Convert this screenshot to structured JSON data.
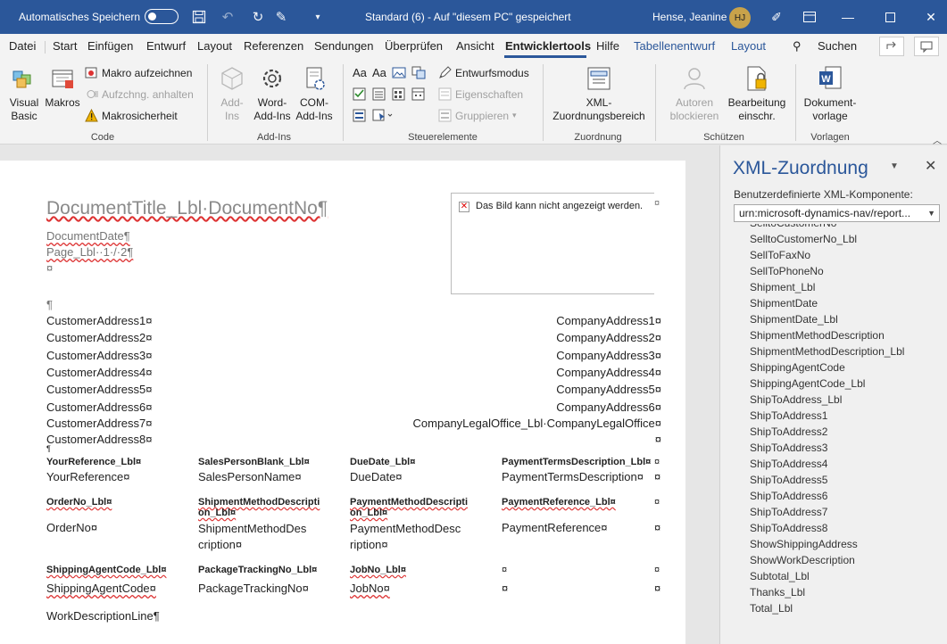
{
  "titlebar": {
    "autosave_label": "Automatisches Speichern",
    "doc_title": "Standard (6)  -  Auf \"diesem PC\" gespeichert",
    "user_name": "Hense, Jeanine",
    "user_initials": "HJ"
  },
  "tabs": [
    "Datei",
    "Start",
    "Einfügen",
    "Entwurf",
    "Layout",
    "Referenzen",
    "Sendungen",
    "Überprüfen",
    "Ansicht",
    "Entwicklertools",
    "Hilfe",
    "Tabellenentwurf",
    "Layout"
  ],
  "search_label": "Suchen",
  "ribbon": {
    "code": {
      "label": "Code",
      "visual_basic": "Visual Basic",
      "macros": "Makros",
      "record_macro": "Makro aufzeichnen",
      "pause_recording": "Aufzchng. anhalten",
      "macro_security": "Makrosicherheit"
    },
    "addins": {
      "label": "Add-Ins",
      "addins": "Add-Ins",
      "word_addins": "Word-Add-Ins",
      "com_addins": "COM-Add-Ins"
    },
    "controls": {
      "label": "Steuerelemente",
      "design_mode": "Entwurfsmodus",
      "properties": "Eigenschaften",
      "group": "Gruppieren"
    },
    "mapping": {
      "label": "Zuordnung",
      "xml_pane": "XML-Zuordnungsbereich"
    },
    "protect": {
      "label": "Schützen",
      "block_authors": "Autoren blockieren",
      "restrict_editing": "Bearbeitung einschr."
    },
    "templates": {
      "label": "Vorlagen",
      "document_template": "Dokument-vorlage"
    }
  },
  "document": {
    "title": "DocumentTitle_Lbl·DocumentNo¶",
    "date": "DocumentDate¶",
    "page": "Page_Lbl··1·/·2¶",
    "mark1": "¤",
    "para": "¶",
    "image_msg": "Das Bild kann nicht angezeigt werden.",
    "customer_addresses": [
      "CustomerAddress1¤",
      "CustomerAddress2¤",
      "CustomerAddress3¤",
      "CustomerAddress4¤",
      "CustomerAddress5¤",
      "CustomerAddress6¤",
      "CustomerAddress7¤",
      "CustomerAddress8¤"
    ],
    "company_addresses": [
      "CompanyAddress1¤",
      "CompanyAddress2¤",
      "CompanyAddress3¤",
      "CompanyAddress4¤",
      "CompanyAddress5¤",
      "CompanyAddress6¤",
      "CompanyLegalOffice_Lbl·CompanyLegalOffice¤",
      "¤"
    ],
    "row1_labels": [
      "YourReference_Lbl¤",
      "SalesPersonBlank_Lbl¤",
      "DueDate_Lbl¤",
      "PaymentTermsDescription_Lbl¤",
      "¤"
    ],
    "row1_values": [
      "YourReference¤",
      "SalesPersonName¤",
      "DueDate¤",
      "PaymentTermsDescription¤",
      "¤"
    ],
    "row2_labels": [
      "OrderNo_Lbl¤",
      "ShipmentMethodDescripti on_Lbl¤",
      "PaymentMethodDescripti on_Lbl¤",
      "PaymentReference_Lbl¤",
      "¤"
    ],
    "row2_values": [
      "OrderNo¤",
      "ShipmentMethodDes cription¤",
      "PaymentMethodDesc ription¤",
      "PaymentReference¤",
      "¤"
    ],
    "row3_labels": [
      "ShippingAgentCode_Lbl¤",
      "PackageTrackingNo_Lbl¤",
      "JobNo_Lbl¤",
      "¤",
      "¤"
    ],
    "row3_values": [
      "ShippingAgentCode¤",
      "PackageTrackingNo¤",
      "JobNo¤",
      "¤",
      "¤"
    ],
    "work_description": "WorkDescriptionLine¶"
  },
  "xml_pane": {
    "title": "XML-Zuordnung",
    "component_label": "Benutzerdefinierte XML-Komponente:",
    "selected_component": "urn:microsoft-dynamics-nav/report...",
    "items": [
      "SelltoCustomerNo",
      "SelltoCustomerNo_Lbl",
      "SellToFaxNo",
      "SellToPhoneNo",
      "Shipment_Lbl",
      "ShipmentDate",
      "ShipmentDate_Lbl",
      "ShipmentMethodDescription",
      "ShipmentMethodDescription_Lbl",
      "ShippingAgentCode",
      "ShippingAgentCode_Lbl",
      "ShipToAddress_Lbl",
      "ShipToAddress1",
      "ShipToAddress2",
      "ShipToAddress3",
      "ShipToAddress4",
      "ShipToAddress5",
      "ShipToAddress6",
      "ShipToAddress7",
      "ShipToAddress8",
      "ShowShippingAddress",
      "ShowWorkDescription",
      "Subtotal_Lbl",
      "Thanks_Lbl",
      "Total_Lbl"
    ]
  }
}
